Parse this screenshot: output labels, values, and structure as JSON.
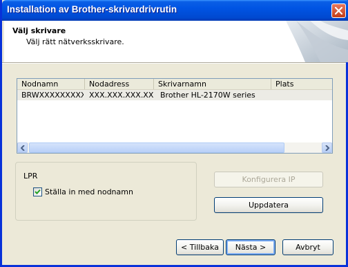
{
  "window": {
    "title": "Installation av Brother-skrivardrivrutin"
  },
  "header": {
    "title": "Välj skrivare",
    "subtitle": "Välj rätt nätverksskrivare."
  },
  "printer_list": {
    "columns": [
      "Nodnamn",
      "Nodadress",
      "Skrivarnamn",
      "Plats"
    ],
    "rows": [
      [
        "BRWXXXXXXXXXX",
        "XXX.XXX.XXX.XX",
        "Brother HL-2170W series",
        ""
      ]
    ]
  },
  "lpr": {
    "group_label": "LPR",
    "checkbox_label": "Ställa in med nodnamn",
    "checked": true
  },
  "buttons": {
    "configure_ip": "Konfigurera IP",
    "update": "Uppdatera",
    "back": "< Tillbaka",
    "next": "Nästa >",
    "cancel": "Avbryt"
  },
  "icons": {
    "close": "close-icon",
    "scroll_left": "arrow-left-icon",
    "scroll_right": "arrow-right-icon",
    "checkmark": "checkmark-icon"
  }
}
